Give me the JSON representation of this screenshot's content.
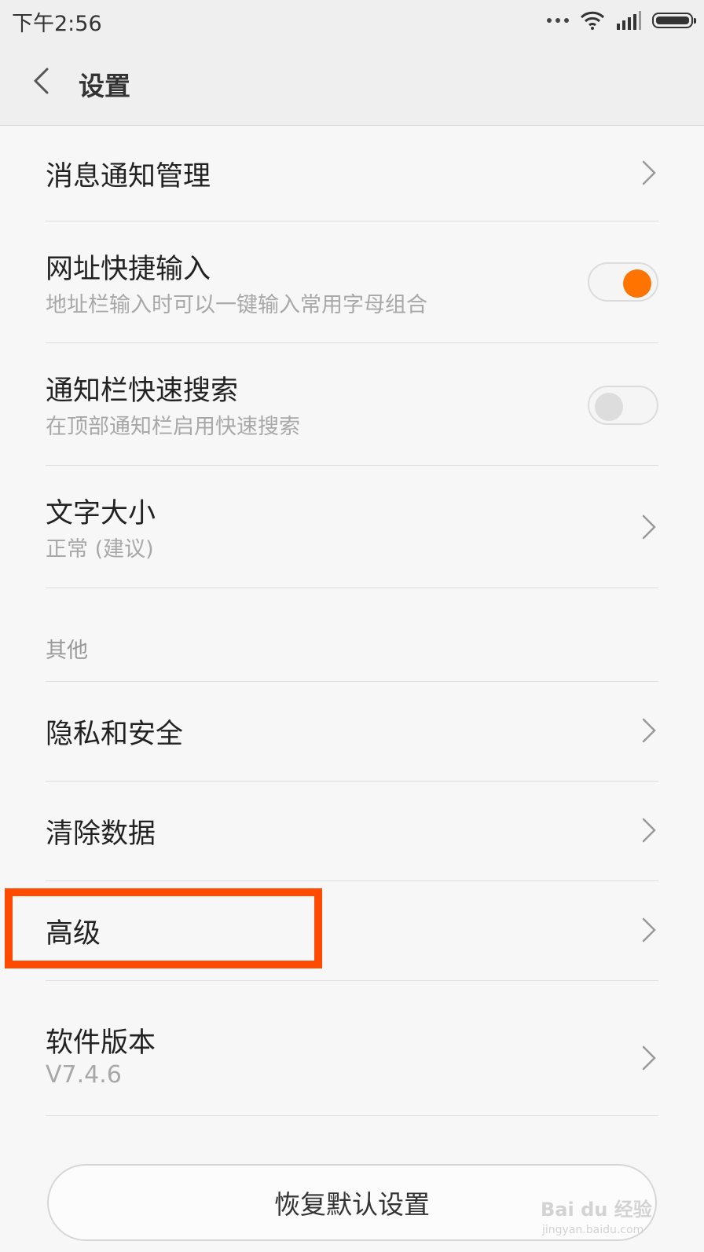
{
  "status_bar": {
    "time": "下午2:56",
    "icons": [
      "more-dots-icon",
      "wifi-icon",
      "signal-icon",
      "battery-icon"
    ]
  },
  "header": {
    "title": "设置",
    "back_icon": "chevron-left-icon"
  },
  "settings": {
    "items": [
      {
        "label": "消息通知管理",
        "type": "link"
      },
      {
        "label": "网址快捷输入",
        "subtitle": "地址栏输入时可以一键输入常用字母组合",
        "type": "toggle",
        "enabled": true
      },
      {
        "label": "通知栏快速搜索",
        "subtitle": "在顶部通知栏启用快速搜索",
        "type": "toggle",
        "enabled": false
      },
      {
        "label": "文字大小",
        "subtitle": "正常 (建议)",
        "type": "link"
      }
    ],
    "other_section": {
      "header": "其他",
      "items": [
        {
          "label": "隐私和安全",
          "type": "link"
        },
        {
          "label": "清除数据",
          "type": "link"
        },
        {
          "label": "高级",
          "type": "link",
          "highlighted": true
        },
        {
          "label": "软件版本",
          "subtitle": "V7.4.6",
          "type": "link"
        }
      ]
    }
  },
  "reset_button": {
    "label": "恢复默认设置"
  },
  "colors": {
    "accent": "#ff7300",
    "highlight": "#ff4a00",
    "background": "#f7f7f7",
    "header_bg": "#efefef"
  },
  "watermark": {
    "text": "Bai du 经验",
    "url": "jingyan.baidu.com"
  }
}
